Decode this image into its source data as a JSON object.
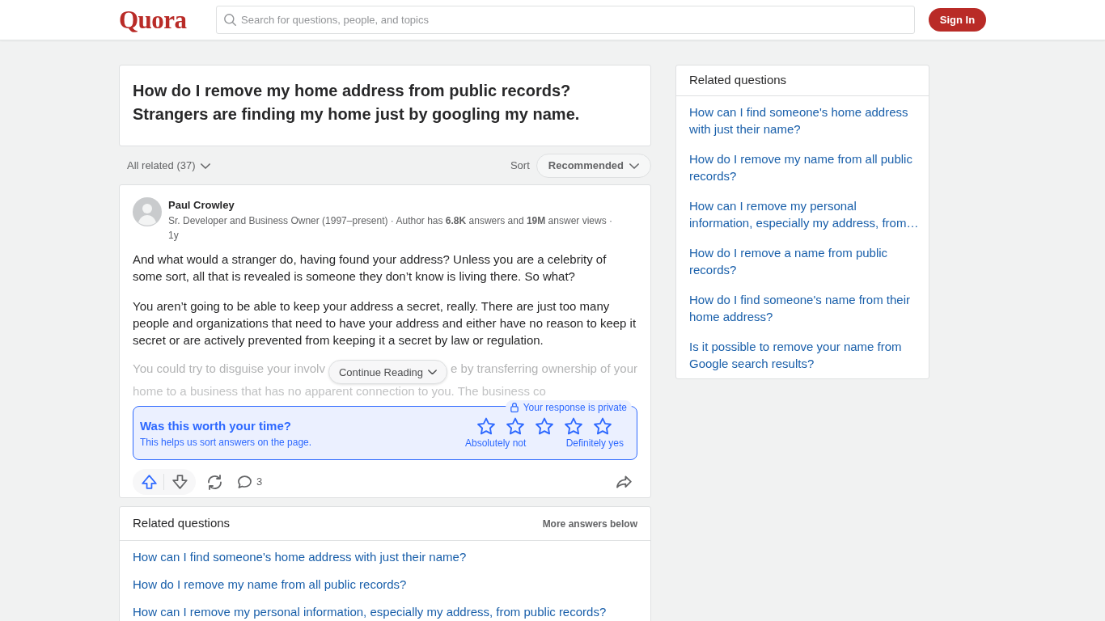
{
  "header": {
    "logo": "Quora",
    "search": {
      "placeholder": "Search for questions, people, and topics"
    },
    "sign_in_button": "Sign In"
  },
  "question": {
    "title": "How do I remove my home address from public records? Strangers are finding my home just by googling my name."
  },
  "filter_bar": {
    "all_related": "All related (37)",
    "sort_label": "Sort",
    "sort_value": "Recommended"
  },
  "answer": {
    "author": "Paul Crowley",
    "credentials": "Sr. Developer and Business Owner (1997–present) · Author has **6.8K** answers and **19M** answer views · 1y",
    "paragraphs": [
      "And what would a stranger do, having found your address? Unless you are a celebrity of some sort, all that is revealed is someone they don’t know is living there. So what?",
      "You aren’t going to be able to keep your address a secret, really. There are just too many people and organizations that need to have your address and either have no reason to keep it secret or are actively prevented from keeping it a secret by law or regulation."
    ],
    "faded_preview": {
      "line_1_left": "You could try to disguise your involv",
      "line_1_right": "e by transferring ownership of your",
      "line_2": "home to a business that has no apparent connection to you. The business co"
    },
    "continue_button": "Continue Reading",
    "rating": {
      "privacy_note": "Your response is private",
      "title": "Was this worth your time?",
      "subtitle": "This helps us sort answers on the page.",
      "stars": 0,
      "low_label": "Absolutely not",
      "high_label": "Definitely yes"
    },
    "actions": {
      "comment_count": "3"
    }
  },
  "related_questions_inline": {
    "title": "Related questions",
    "more_label": "More answers below",
    "items": [
      "How can I find someone's home address with just their name?",
      "How do I remove my name from all public records?",
      "How can I remove my personal information, especially my address, from public records?"
    ]
  },
  "sidebar_related": {
    "title": "Related questions",
    "items": [
      "How can I find someone's home address with just their name?",
      "How do I remove my name from all public records?",
      "How can I remove my personal information, especially my address, from…",
      "How do I remove a name from public records?",
      "How do I find someone's name from their home address?",
      "Is it possible to remove your name from Google search results?"
    ]
  }
}
